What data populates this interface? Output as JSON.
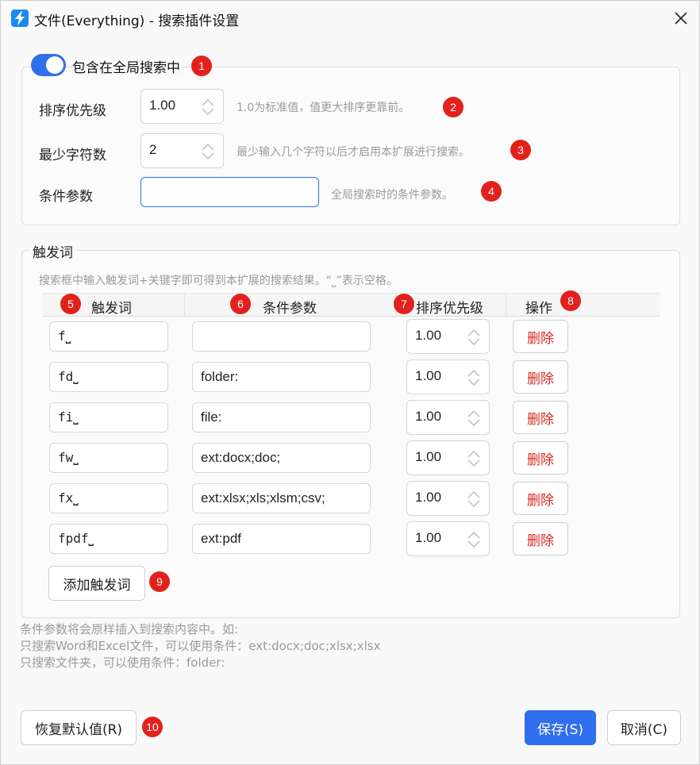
{
  "window": {
    "title": "文件(Everything) - 搜索插件设置"
  },
  "global": {
    "include_label": "包含在全局搜索中",
    "include_checked": true,
    "priority_label": "排序优先级",
    "priority_value": "1.00",
    "priority_hint": "1.0为标准值，值更大排序更靠前。",
    "min_chars_label": "最少字符数",
    "min_chars_value": "2",
    "min_chars_hint": "最少输入几个字符以后才启用本扩展进行搜索。",
    "condition_label": "条件参数",
    "condition_value": "",
    "condition_hint": "全局搜索时的条件参数。"
  },
  "trigger": {
    "group_title": "触发词",
    "description": "搜索框中输入触发词+关键字即可得到本扩展的搜索结果。“⎵”表示空格。",
    "columns": [
      "触发词",
      "条件参数",
      "排序优先级",
      "操作"
    ],
    "rows": [
      {
        "word": "f⎵",
        "condition": "",
        "priority": "1.00",
        "action": "删除"
      },
      {
        "word": "fd⎵",
        "condition": "folder:",
        "priority": "1.00",
        "action": "删除"
      },
      {
        "word": "fi⎵",
        "condition": "file:",
        "priority": "1.00",
        "action": "删除"
      },
      {
        "word": "fw⎵",
        "condition": "ext:docx;doc;",
        "priority": "1.00",
        "action": "删除"
      },
      {
        "word": "fx⎵",
        "condition": "ext:xlsx;xls;xlsm;csv;",
        "priority": "1.00",
        "action": "删除"
      },
      {
        "word": "fpdf⎵",
        "condition": "ext:pdf",
        "priority": "1.00",
        "action": "删除"
      }
    ],
    "add_button": "添加触发词"
  },
  "notes": [
    "条件参数将会原样插入到搜索内容中。如:",
    "只搜索Word和Excel文件，可以使用条件：ext:docx;doc;xlsx;xlsx",
    "只搜索文件夹，可以使用条件：folder:"
  ],
  "footer": {
    "reset_button": "恢复默认值(R)",
    "save_button": "保存(S)",
    "cancel_button": "取消(C)"
  },
  "badges": [
    "1",
    "2",
    "3",
    "4",
    "5",
    "6",
    "7",
    "8",
    "9",
    "10"
  ],
  "colors": {
    "accent": "#2f6fec",
    "delete": "#d8281f",
    "badge": "#e2211c",
    "hint": "#9a9a9a"
  },
  "icons": {
    "app": "lightning-bolt-icon",
    "close": "close-icon",
    "spinner": "chevron-up-down-icon"
  }
}
